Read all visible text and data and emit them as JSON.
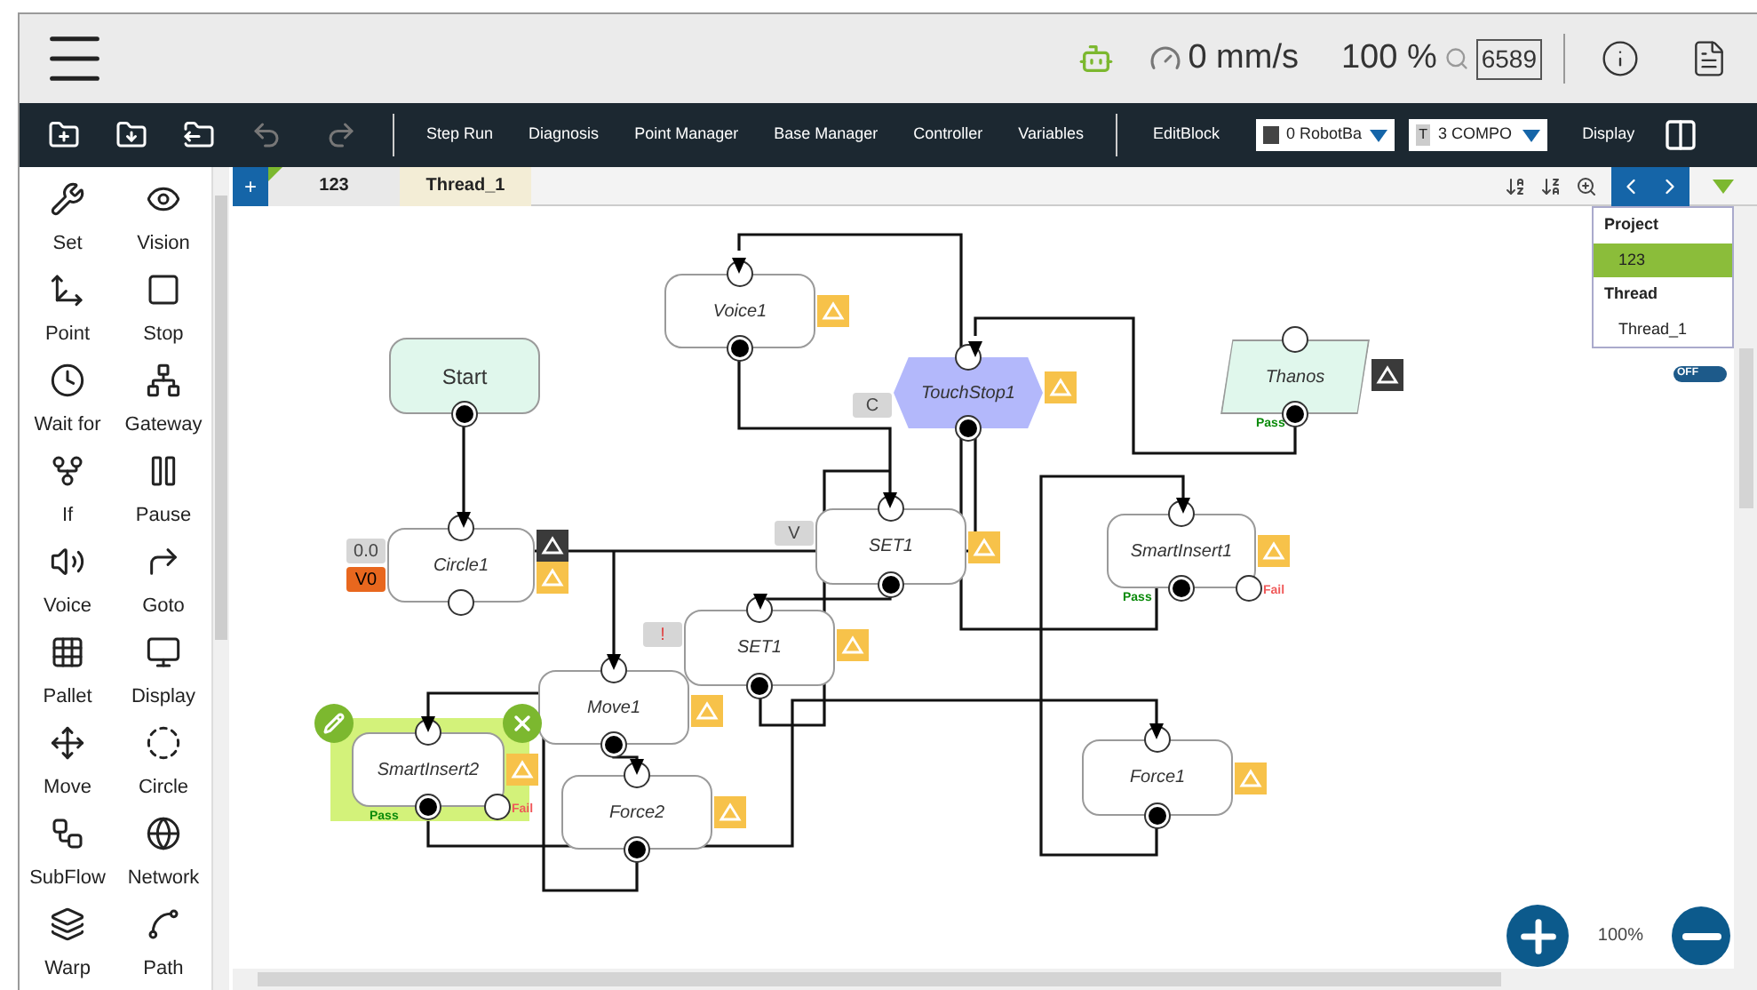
{
  "header": {
    "speed": "0 mm/s",
    "override": "100 %",
    "counter": "6589"
  },
  "toolbar": {
    "buttons": [
      "Step Run",
      "Diagnosis",
      "Point Manager",
      "Base Manager",
      "Controller",
      "Variables"
    ],
    "edit_block": "EditBlock",
    "dropdowns": [
      {
        "label": "0 RobotBa",
        "kind": "robot"
      },
      {
        "badge": "T",
        "label": "3 COMPO",
        "kind": "tool"
      }
    ],
    "display": "Display"
  },
  "tabs": {
    "add": "+",
    "items": [
      {
        "label": "123",
        "selected": false
      },
      {
        "label": "Thread_1",
        "selected": true
      }
    ]
  },
  "palette": [
    {
      "label": "Set"
    },
    {
      "label": "Vision"
    },
    {
      "label": "Point"
    },
    {
      "label": "Stop"
    },
    {
      "label": "Wait for"
    },
    {
      "label": "Gateway"
    },
    {
      "label": "If"
    },
    {
      "label": "Pause"
    },
    {
      "label": "Voice"
    },
    {
      "label": "Goto"
    },
    {
      "label": "Pallet"
    },
    {
      "label": "Display"
    },
    {
      "label": "Move"
    },
    {
      "label": "Circle"
    },
    {
      "label": "SubFlow"
    },
    {
      "label": "Network"
    },
    {
      "label": "Warp"
    },
    {
      "label": "Path"
    }
  ],
  "nodes": [
    {
      "kind": "start",
      "label": "Start",
      "selected": false
    },
    {
      "kind": "block",
      "label": "Voice1",
      "selected": false
    },
    {
      "kind": "hexagon",
      "label": "TouchStop1",
      "selected": false,
      "badges": [
        {
          "text": "C",
          "kind": "gray"
        }
      ]
    },
    {
      "kind": "parallelogram",
      "label": "Thanos",
      "selected": false,
      "pass": "Pass"
    },
    {
      "kind": "block",
      "label": "Circle1",
      "selected": false,
      "badges": [
        {
          "text": "0.0",
          "kind": "gray"
        },
        {
          "text": "V0",
          "kind": "orange"
        }
      ]
    },
    {
      "kind": "block",
      "label": "SET1",
      "selected": false,
      "badges": [
        {
          "text": "V",
          "kind": "gray"
        }
      ]
    },
    {
      "kind": "block",
      "label": "SmartInsert1",
      "selected": false,
      "pass": "Pass",
      "fail": "Fail"
    },
    {
      "kind": "block",
      "label": "SET1",
      "selected": false,
      "badges": [
        {
          "text": "!",
          "kind": "alert"
        }
      ]
    },
    {
      "kind": "block",
      "label": "Move1",
      "selected": false
    },
    {
      "kind": "block",
      "label": "Force2",
      "selected": false
    },
    {
      "kind": "block",
      "label": "SmartInsert2",
      "selected": true,
      "pass": "Pass",
      "fail": "Fail"
    },
    {
      "kind": "block",
      "label": "Force1",
      "selected": false
    }
  ],
  "tree_panel": {
    "sections": [
      {
        "title": "Project",
        "items": [
          {
            "label": "123",
            "selected": true
          }
        ]
      },
      {
        "title": "Thread",
        "items": [
          {
            "label": "Thread_1",
            "selected": false
          }
        ]
      }
    ]
  },
  "toggle": {
    "label": "OFF",
    "on": false
  },
  "zoom": {
    "reading": "100%"
  }
}
